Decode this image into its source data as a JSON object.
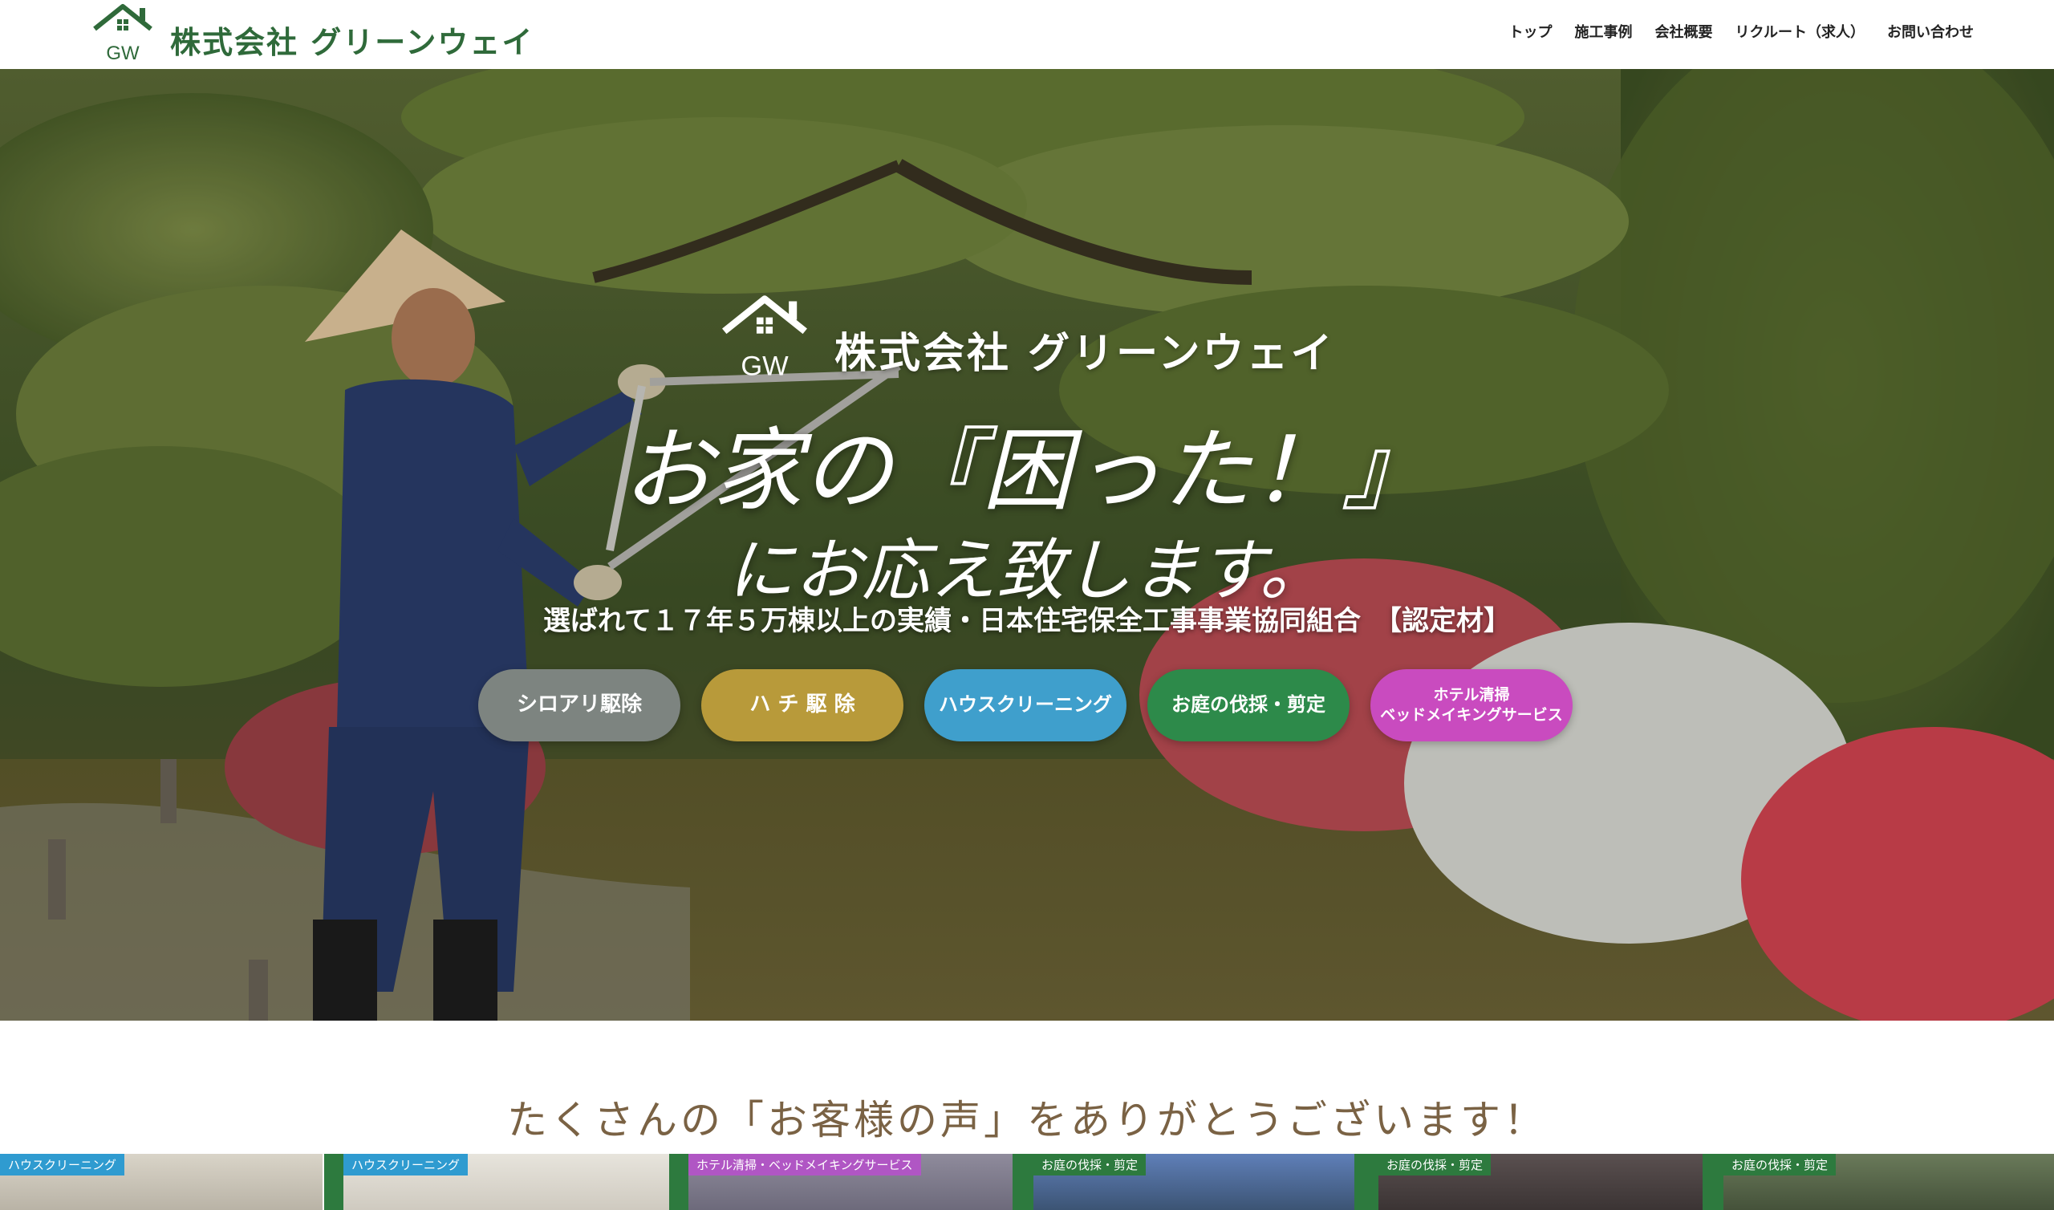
{
  "header": {
    "brand": "株式会社 グリーンウェイ",
    "logo_text": "GW",
    "nav": [
      "トップ",
      "施工事例",
      "会社概要",
      "リクルート（求人）",
      "お問い合わせ"
    ]
  },
  "hero": {
    "brand": "株式会社 グリーンウェイ",
    "logo_text": "GW",
    "headline_1": "お家の『困った！』",
    "headline_2": "にお応え致します。",
    "subline": "選ばれて１７年５万棟以上の実績・日本住宅保全工事事業協同組合　【認定材】",
    "services": [
      {
        "label": "シロアリ駆除",
        "color": "#7d8480"
      },
      {
        "label": "ハ チ 駆 除",
        "color": "#b89a3a"
      },
      {
        "label": "ハウスクリーニング",
        "color": "#3f9fcc"
      },
      {
        "label": "お庭の伐採・剪定",
        "color": "#2d8a4a"
      },
      {
        "label": "ホテル清掃\nベッドメイキングサービス",
        "color": "#c94bbf"
      }
    ]
  },
  "voices": {
    "title": "たくさんの「お客様の声」をありがとうございます！",
    "cards": [
      {
        "tag": "ハウスクリーニング",
        "tag_color": "#2f9bd0"
      },
      {
        "tag": "ハウスクリーニング",
        "tag_color": "#2f9bd0"
      },
      {
        "tag": "ホテル清掃・ベッドメイキングサービス",
        "tag_color": "#b056c4"
      },
      {
        "tag": "お庭の伐採・剪定",
        "tag_color": "#2d7a3e"
      },
      {
        "tag": "お庭の伐採・剪定",
        "tag_color": "#2d7a3e"
      },
      {
        "tag": "お庭の伐採・剪定",
        "tag_color": "#2d7a3e"
      }
    ]
  }
}
